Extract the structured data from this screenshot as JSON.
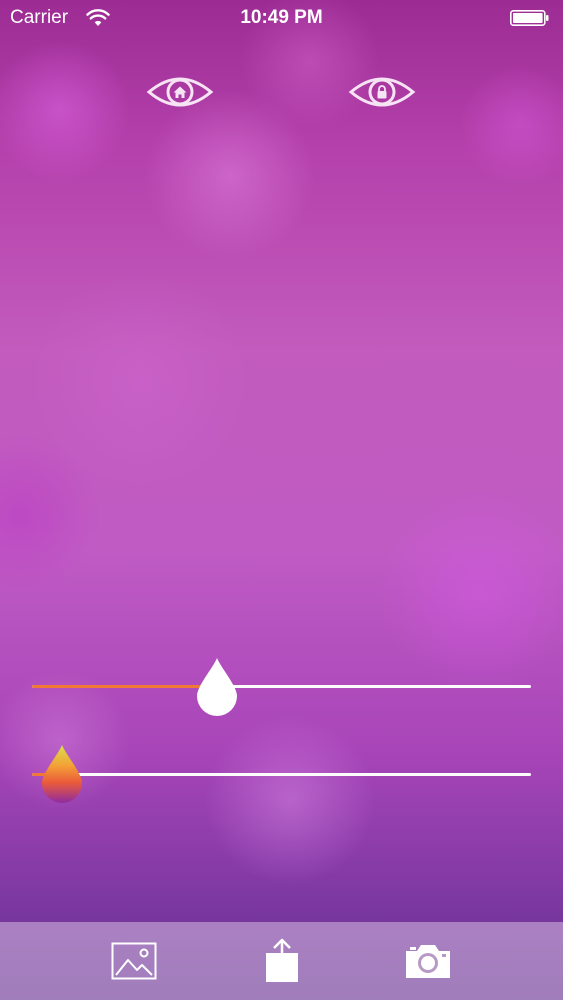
{
  "status_bar": {
    "carrier": "Carrier",
    "time": "10:49 PM"
  },
  "header_icons": [
    {
      "name": "eye-home-icon",
      "symbol": "house"
    },
    {
      "name": "eye-lock-icon",
      "symbol": "lock"
    }
  ],
  "sliders": [
    {
      "name": "blur-slider",
      "value": 0.37,
      "fill_color": "#f07a35",
      "thumb_style": "white-drop"
    },
    {
      "name": "color-slider",
      "value": 0.06,
      "fill_color": "#f07a35",
      "thumb_style": "gradient-drop"
    }
  ],
  "toolbar": {
    "buttons": [
      {
        "name": "photo-library-button",
        "icon": "image-icon"
      },
      {
        "name": "share-button",
        "icon": "share-icon"
      },
      {
        "name": "camera-button",
        "icon": "camera-icon"
      }
    ]
  },
  "colors": {
    "accent": "#f07a35",
    "icon": "#ffffff"
  }
}
